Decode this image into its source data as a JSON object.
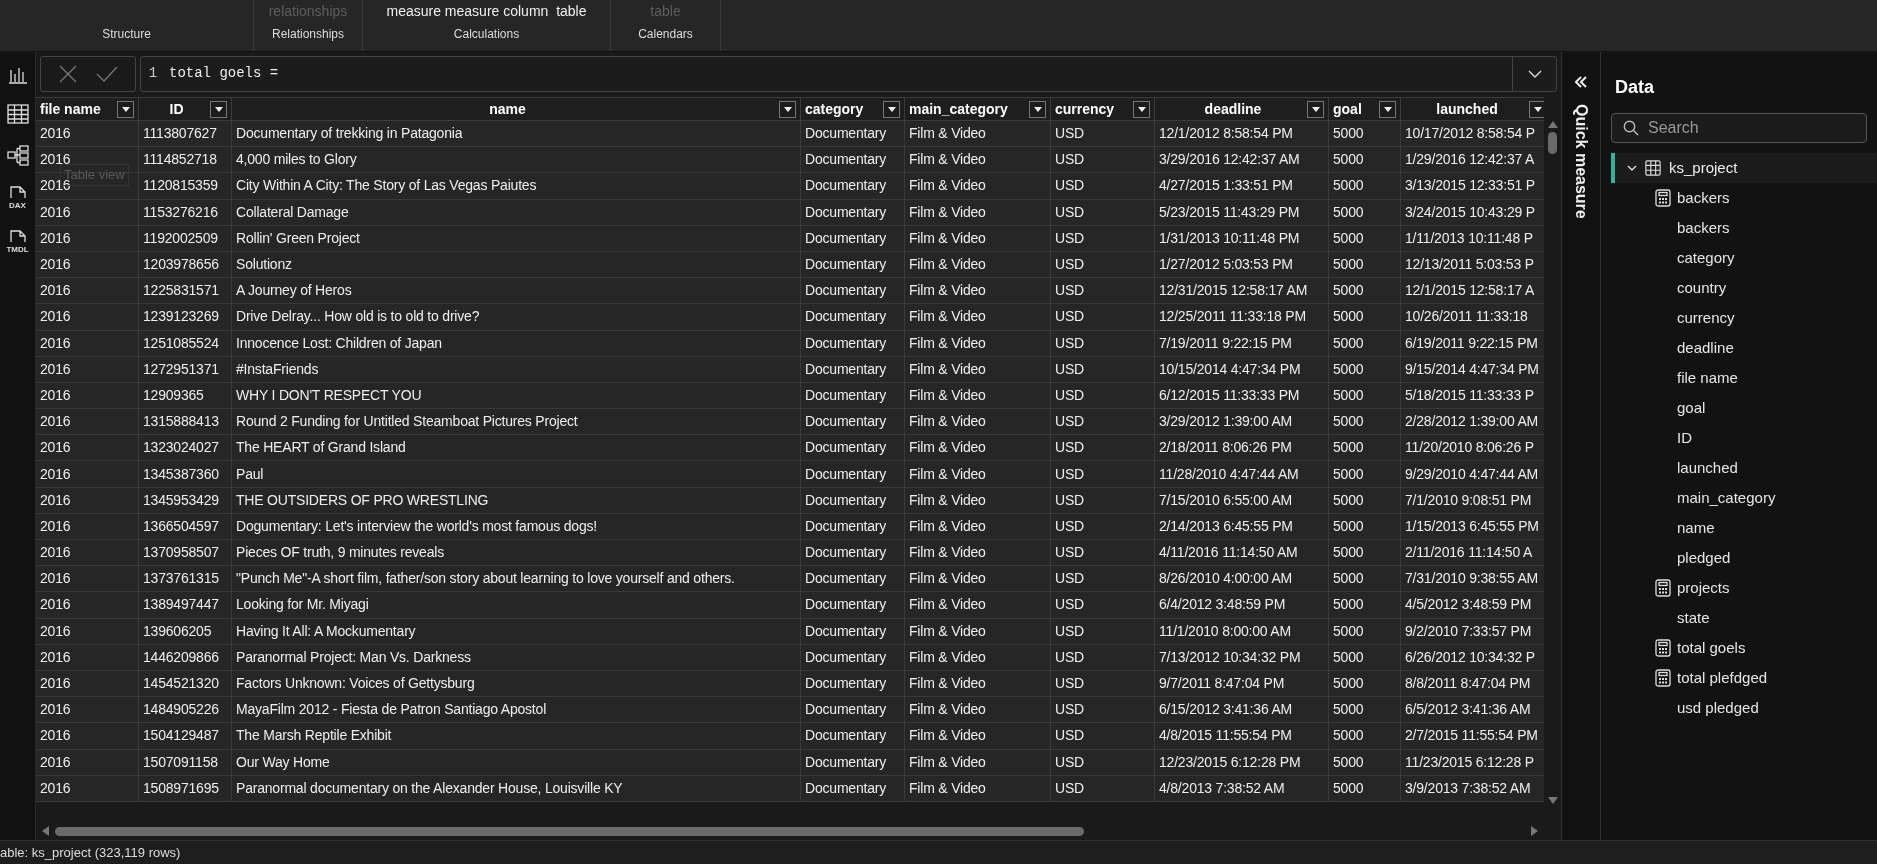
{
  "ribbon": {
    "groups": [
      {
        "label": "Structure"
      },
      {
        "top": "relationships",
        "top_disabled": true,
        "label": "Relationships"
      },
      {
        "top": "measure measure column  table",
        "top_disabled": false,
        "label": "Calculations"
      },
      {
        "top": "table",
        "top_disabled": true,
        "label": "Calendars"
      }
    ]
  },
  "left_rail": [
    {
      "kind": "report"
    },
    {
      "kind": "table"
    },
    {
      "kind": "model"
    },
    {
      "kind": "file",
      "label": "DAX"
    },
    {
      "kind": "file",
      "label": "TMDL"
    }
  ],
  "formula_bar": {
    "line_number": "1",
    "formula": "total goels ="
  },
  "tooltip": "Table view",
  "table": {
    "columns": [
      "file name",
      "ID",
      "name",
      "category",
      "main_category",
      "currency",
      "deadline",
      "goal",
      "launched"
    ],
    "rows": [
      [
        "2016",
        "1113807627",
        "Documentary of trekking in Patagonia",
        "Documentary",
        "Film & Video",
        "USD",
        "12/1/2012 8:58:54 PM",
        "5000",
        "10/17/2012 8:58:54 P"
      ],
      [
        "2016",
        "1114852718",
        "4,000 miles to Glory",
        "Documentary",
        "Film & Video",
        "USD",
        "3/29/2016 12:42:37 AM",
        "5000",
        "1/29/2016 12:42:37 A"
      ],
      [
        "2016",
        "1120815359",
        "City Within A City: The Story of Las Vegas Paiutes",
        "Documentary",
        "Film & Video",
        "USD",
        "4/27/2015 1:33:51 PM",
        "5000",
        "3/13/2015 12:33:51 P"
      ],
      [
        "2016",
        "1153276216",
        "Collateral Damage",
        "Documentary",
        "Film & Video",
        "USD",
        "5/23/2015 11:43:29 PM",
        "5000",
        "3/24/2015 10:43:29 P"
      ],
      [
        "2016",
        "1192002509",
        "Rollin' Green Project",
        "Documentary",
        "Film & Video",
        "USD",
        "1/31/2013 10:11:48 PM",
        "5000",
        "1/11/2013 10:11:48 P"
      ],
      [
        "2016",
        "1203978656",
        "Solutionz",
        "Documentary",
        "Film & Video",
        "USD",
        "1/27/2012 5:03:53 PM",
        "5000",
        "12/13/2011 5:03:53 P"
      ],
      [
        "2016",
        "1225831571",
        "A Journey of Heros",
        "Documentary",
        "Film & Video",
        "USD",
        "12/31/2015 12:58:17 AM",
        "5000",
        "12/1/2015 12:58:17 A"
      ],
      [
        "2016",
        "1239123269",
        "Drive Delray... How old is to old to drive?",
        "Documentary",
        "Film & Video",
        "USD",
        "12/25/2011 11:33:18 PM",
        "5000",
        "10/26/2011 11:33:18"
      ],
      [
        "2016",
        "1251085524",
        "Innocence Lost: Children of Japan",
        "Documentary",
        "Film & Video",
        "USD",
        "7/19/2011 9:22:15 PM",
        "5000",
        "6/19/2011 9:22:15 PM"
      ],
      [
        "2016",
        "1272951371",
        "#InstaFriends",
        "Documentary",
        "Film & Video",
        "USD",
        "10/15/2014 4:47:34 PM",
        "5000",
        "9/15/2014 4:47:34 PM"
      ],
      [
        "2016",
        "12909365",
        "WHY I DON'T RESPECT YOU",
        "Documentary",
        "Film & Video",
        "USD",
        "6/12/2015 11:33:33 PM",
        "5000",
        "5/18/2015 11:33:33 P"
      ],
      [
        "2016",
        "1315888413",
        "Round 2 Funding for Untitled Steamboat Pictures Project",
        "Documentary",
        "Film & Video",
        "USD",
        "3/29/2012 1:39:00 AM",
        "5000",
        "2/28/2012 1:39:00 AM"
      ],
      [
        "2016",
        "1323024027",
        "The HEART of Grand Island",
        "Documentary",
        "Film & Video",
        "USD",
        "2/18/2011 8:06:26 PM",
        "5000",
        "11/20/2010 8:06:26 P"
      ],
      [
        "2016",
        "1345387360",
        "Paul",
        "Documentary",
        "Film & Video",
        "USD",
        "11/28/2010 4:47:44 AM",
        "5000",
        "9/29/2010 4:47:44 AM"
      ],
      [
        "2016",
        "1345953429",
        "THE OUTSIDERS OF PRO WRESTLING",
        "Documentary",
        "Film & Video",
        "USD",
        "7/15/2010 6:55:00 AM",
        "5000",
        "7/1/2010 9:08:51 PM"
      ],
      [
        "2016",
        "1366504597",
        "Dogumentary: Let's interview the world's most famous dogs!",
        "Documentary",
        "Film & Video",
        "USD",
        "2/14/2013 6:45:55 PM",
        "5000",
        "1/15/2013 6:45:55 PM"
      ],
      [
        "2016",
        "1370958507",
        "Pieces OF truth, 9 minutes reveals",
        "Documentary",
        "Film & Video",
        "USD",
        "4/11/2016 11:14:50 AM",
        "5000",
        "2/11/2016 11:14:50 A"
      ],
      [
        "2016",
        "1373761315",
        "\"Punch Me\"-A short film, father/son story about learning to love yourself and others.",
        "Documentary",
        "Film & Video",
        "USD",
        "8/26/2010 4:00:00 AM",
        "5000",
        "7/31/2010 9:38:55 AM"
      ],
      [
        "2016",
        "1389497447",
        "Looking for Mr. Miyagi",
        "Documentary",
        "Film & Video",
        "USD",
        "6/4/2012 3:48:59 PM",
        "5000",
        "4/5/2012 3:48:59 PM"
      ],
      [
        "2016",
        "139606205",
        "Having It All: A Mockumentary",
        "Documentary",
        "Film & Video",
        "USD",
        "11/1/2010 8:00:00 AM",
        "5000",
        "9/2/2010 7:33:57 PM"
      ],
      [
        "2016",
        "1446209866",
        "Paranormal Project: Man Vs. Darkness",
        "Documentary",
        "Film & Video",
        "USD",
        "7/13/2012 10:34:32 PM",
        "5000",
        "6/26/2012 10:34:32 P"
      ],
      [
        "2016",
        "1454521320",
        "Factors Unknown: Voices of Gettysburg",
        "Documentary",
        "Film & Video",
        "USD",
        "9/7/2011 8:47:04 PM",
        "5000",
        "8/8/2011 8:47:04 PM"
      ],
      [
        "2016",
        "1484905226",
        "MayaFilm 2012 - Fiesta de Patron Santiago Apostol",
        "Documentary",
        "Film & Video",
        "USD",
        "6/15/2012 3:41:36 AM",
        "5000",
        "6/5/2012 3:41:36 AM"
      ],
      [
        "2016",
        "1504129487",
        "The Marsh Reptile Exhibit",
        "Documentary",
        "Film & Video",
        "USD",
        "4/8/2015 11:55:54 PM",
        "5000",
        "2/7/2015 11:55:54 PM"
      ],
      [
        "2016",
        "1507091158",
        "Our Way Home",
        "Documentary",
        "Film & Video",
        "USD",
        "12/23/2015 6:12:28 PM",
        "5000",
        "11/23/2015 6:12:28 P"
      ],
      [
        "2016",
        "1508971695",
        "Paranormal documentary on the Alexander House, Louisville KY",
        "Documentary",
        "Film & Video",
        "USD",
        "4/8/2013 7:38:52 AM",
        "5000",
        "3/9/2013 7:38:52 AM"
      ]
    ]
  },
  "quick_measure": "Quick measure",
  "data_pane": {
    "title": "Data",
    "search": {
      "placeholder": "Search"
    },
    "tree": [
      {
        "label": "ks_project",
        "kind": "table",
        "expanded": true,
        "selected": true,
        "children": [
          {
            "label": "backers",
            "kind": "measure"
          },
          {
            "label": "backers",
            "kind": "column"
          },
          {
            "label": "category",
            "kind": "column"
          },
          {
            "label": "country",
            "kind": "column"
          },
          {
            "label": "currency",
            "kind": "column"
          },
          {
            "label": "deadline",
            "kind": "column"
          },
          {
            "label": "file name",
            "kind": "column"
          },
          {
            "label": "goal",
            "kind": "column"
          },
          {
            "label": "ID",
            "kind": "column"
          },
          {
            "label": "launched",
            "kind": "column"
          },
          {
            "label": "main_category",
            "kind": "column"
          },
          {
            "label": "name",
            "kind": "column"
          },
          {
            "label": "pledged",
            "kind": "column"
          },
          {
            "label": "projects",
            "kind": "measure"
          },
          {
            "label": "state",
            "kind": "column"
          },
          {
            "label": "total goels",
            "kind": "measure"
          },
          {
            "label": "total plefdged",
            "kind": "measure"
          },
          {
            "label": "usd pledged",
            "kind": "column"
          }
        ]
      }
    ]
  },
  "status_bar": "able: ks_project (323,119 rows)"
}
